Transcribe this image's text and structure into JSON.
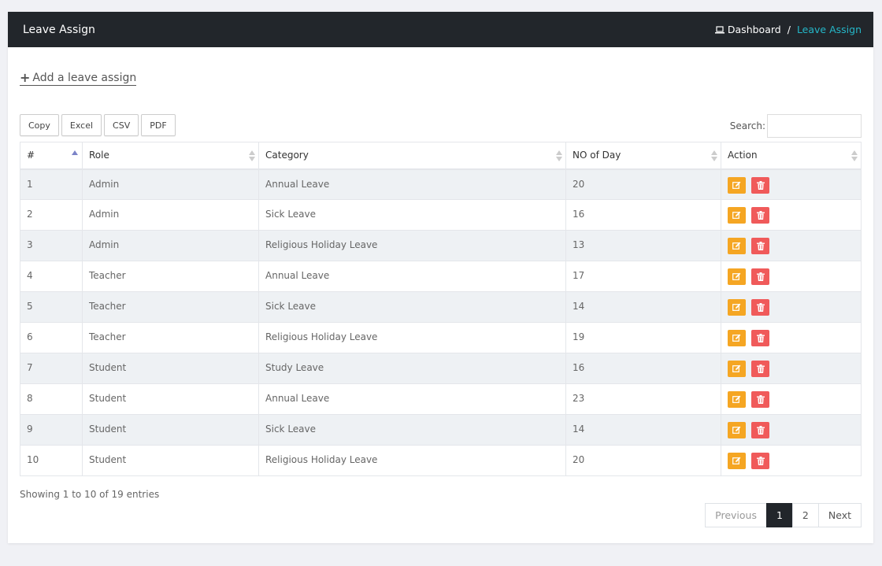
{
  "header": {
    "title": "Leave Assign",
    "crumb_home": "Dashboard",
    "crumb_sep": "/",
    "crumb_active": "Leave Assign"
  },
  "add_link": "Add a leave assign",
  "toolbar": [
    "Copy",
    "Excel",
    "CSV",
    "PDF"
  ],
  "search": {
    "label": "Search:",
    "value": ""
  },
  "columns": [
    "#",
    "Role",
    "Category",
    "NO of Day",
    "Action"
  ],
  "rows": [
    [
      "1",
      "Admin",
      "Annual Leave",
      "20"
    ],
    [
      "2",
      "Admin",
      "Sick Leave",
      "16"
    ],
    [
      "3",
      "Admin",
      "Religious Holiday Leave",
      "13"
    ],
    [
      "4",
      "Teacher",
      "Annual Leave",
      "17"
    ],
    [
      "5",
      "Teacher",
      "Sick Leave",
      "14"
    ],
    [
      "6",
      "Teacher",
      "Religious Holiday Leave",
      "19"
    ],
    [
      "7",
      "Student",
      "Study Leave",
      "16"
    ],
    [
      "8",
      "Student",
      "Annual Leave",
      "23"
    ],
    [
      "9",
      "Student",
      "Sick Leave",
      "14"
    ],
    [
      "10",
      "Student",
      "Religious Holiday Leave",
      "20"
    ]
  ],
  "info": "Showing 1 to 10 of 19 entries",
  "pagination": {
    "previous": "Previous",
    "pages": [
      "1",
      "2"
    ],
    "current": "1",
    "next": "Next"
  },
  "colors": {
    "edit": "#f5a623",
    "delete": "#f05a5a",
    "accent": "#25b7c8",
    "header": "#22262b"
  }
}
